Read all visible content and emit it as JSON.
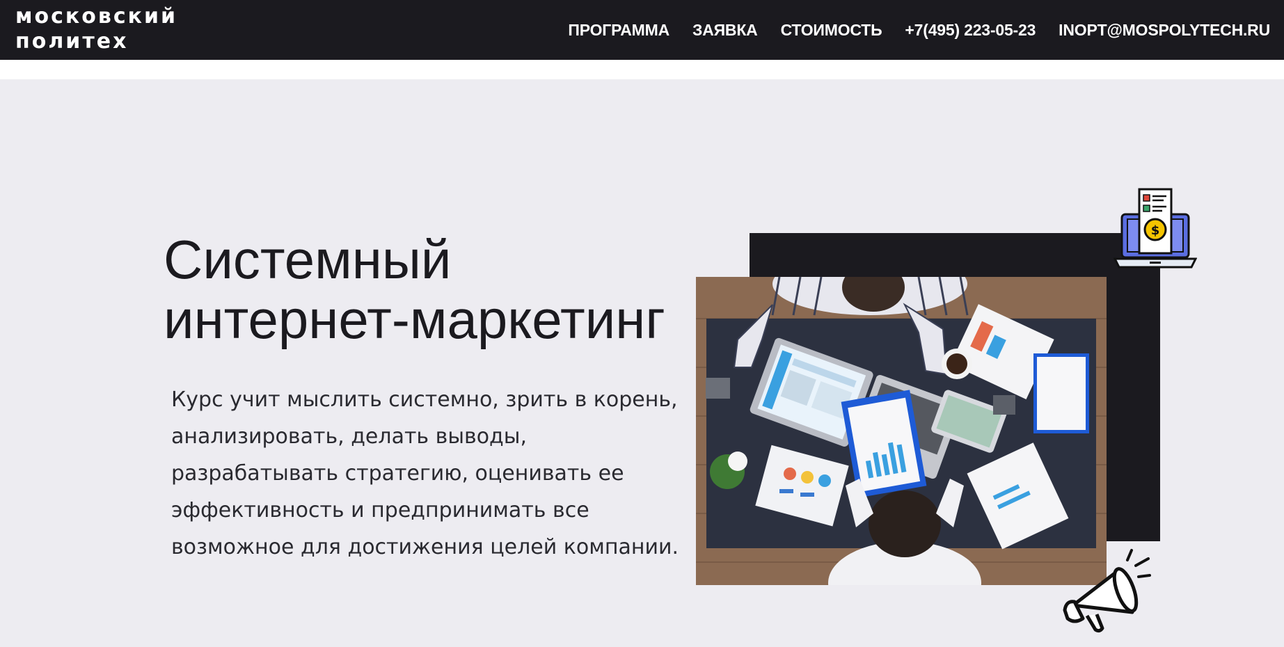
{
  "header": {
    "logo_line1": "московский",
    "logo_line2": "политех",
    "nav": [
      {
        "label": "ПРОГРАММА"
      },
      {
        "label": "ЗАЯВКА"
      },
      {
        "label": "СТОИМОСТЬ"
      },
      {
        "label": "+7(495) 223-05-23"
      },
      {
        "label": "INOPT@MOSPOLYTECH.RU"
      }
    ]
  },
  "hero": {
    "title_line1": "Системный",
    "title_line2": "интернет-маркетинг",
    "description": "Курс учит мыслить системно, зрить в корень, анализировать, делать выводы, разрабатывать стратегию, оценивать ее эффективность и предпринимать все возможное для достижения целей компании."
  },
  "icons": {
    "top": "laptop-invoice-icon",
    "bottom": "megaphone-icon"
  },
  "colors": {
    "header_bg": "#1b1a1f",
    "page_bg": "#edecf1",
    "accent": "#5b6ee1",
    "coin": "#f5c400"
  }
}
